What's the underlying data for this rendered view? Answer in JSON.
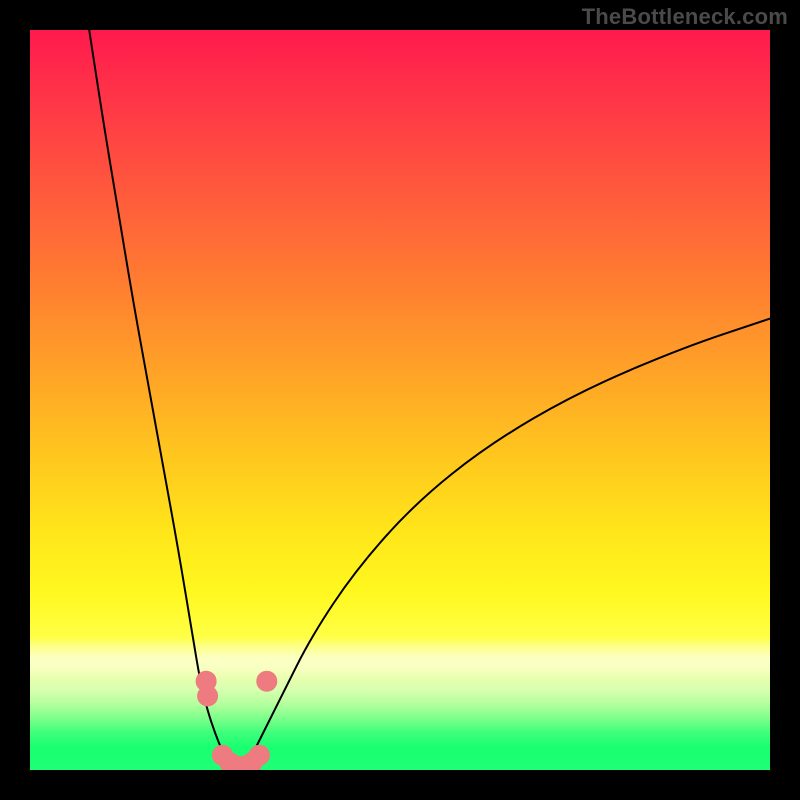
{
  "watermark": "TheBottleneck.com",
  "chart_data": {
    "type": "line",
    "title": "",
    "xlabel": "",
    "ylabel": "",
    "xlim": [
      0,
      100
    ],
    "ylim": [
      0,
      100
    ],
    "grid": false,
    "legend": false,
    "series": [
      {
        "name": "left-curve",
        "x": [
          8,
          10,
          12,
          14,
          16,
          18,
          20,
          22,
          23,
          24,
          25,
          26,
          27,
          28
        ],
        "values": [
          100,
          87,
          75,
          63,
          52,
          41,
          30,
          18,
          12,
          8,
          5,
          2.5,
          1,
          0
        ]
      },
      {
        "name": "right-curve",
        "x": [
          28,
          29,
          30,
          31,
          32,
          34,
          38,
          44,
          52,
          62,
          74,
          88,
          100
        ],
        "values": [
          0,
          1,
          2,
          4,
          6,
          10,
          18,
          27,
          36,
          44,
          51,
          57,
          61
        ]
      }
    ],
    "markers": [
      {
        "name": "left-knee-pair",
        "x": 23.8,
        "y": 12.0
      },
      {
        "name": "left-knee-pair-2",
        "x": 24.0,
        "y": 10.0
      },
      {
        "name": "right-knee",
        "x": 32.0,
        "y": 12.0
      },
      {
        "name": "bottom-cluster-a",
        "x": 26.0,
        "y": 2.0
      },
      {
        "name": "bottom-cluster-b",
        "x": 27.0,
        "y": 1.0
      },
      {
        "name": "bottom-cluster-c",
        "x": 28.0,
        "y": 0.5
      },
      {
        "name": "bottom-cluster-d",
        "x": 29.0,
        "y": 0.5
      },
      {
        "name": "bottom-cluster-e",
        "x": 30.0,
        "y": 1.0
      },
      {
        "name": "bottom-cluster-f",
        "x": 31.0,
        "y": 2.0
      }
    ],
    "colors": {
      "curve": "#000000",
      "markers": "#ee7b7f",
      "gradient_top": "#ff1a4d",
      "gradient_mid": "#ffe61a",
      "gradient_bottom": "#1fff77"
    }
  }
}
